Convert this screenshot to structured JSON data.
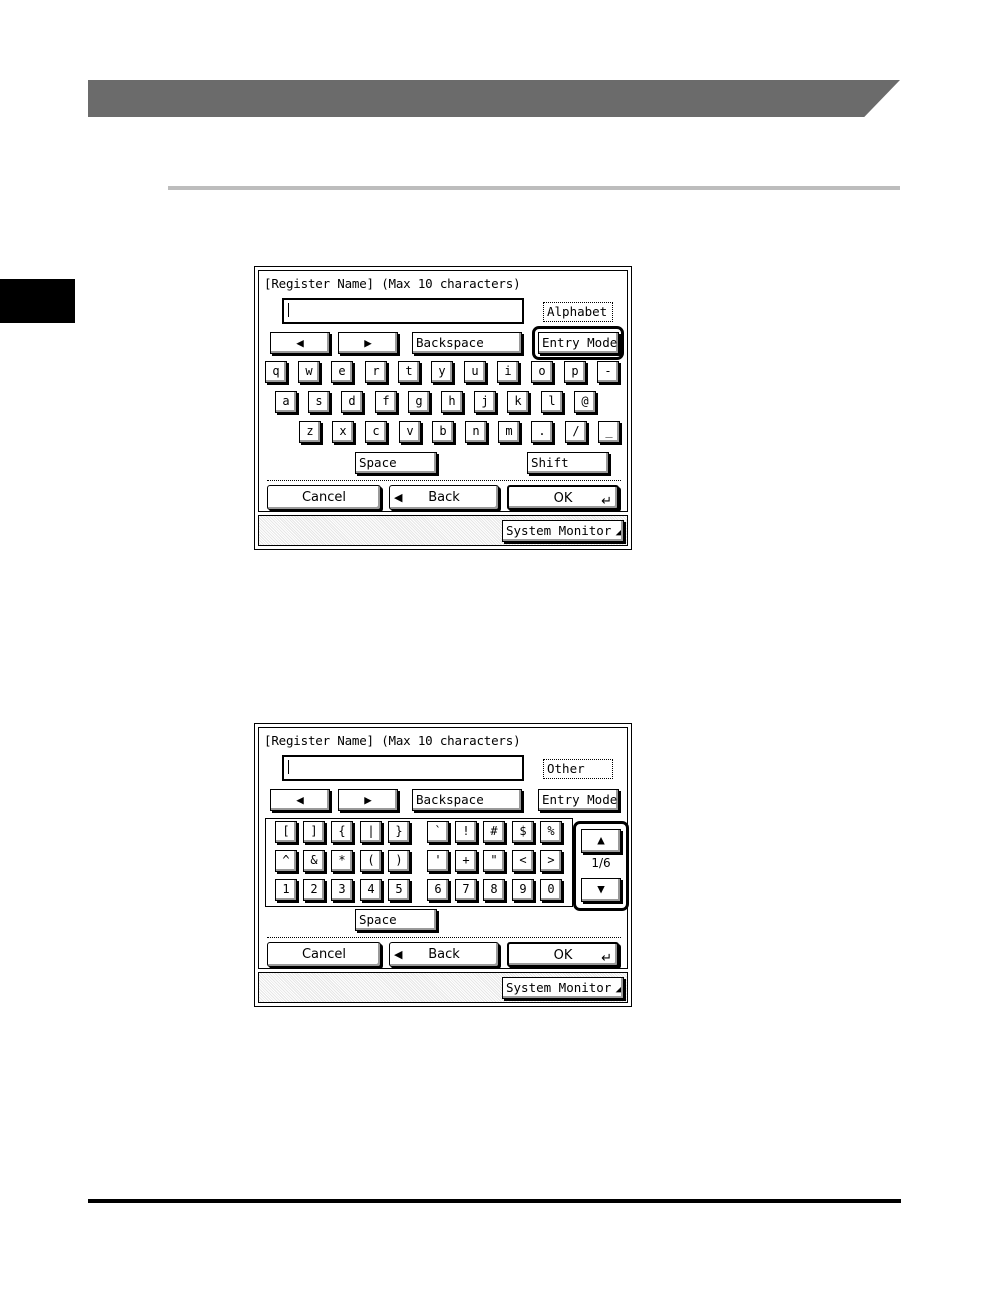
{
  "screen1": {
    "title": "[Register Name] (Max 10 characters)",
    "mode": "Alphabet",
    "left_icon": "◀",
    "right_icon": "▶",
    "backspace": "Backspace",
    "entry_mode": "Entry Mode",
    "rows": [
      [
        "q",
        "w",
        "e",
        "r",
        "t",
        "y",
        "u",
        "i",
        "o",
        "p",
        "-"
      ],
      [
        "a",
        "s",
        "d",
        "f",
        "g",
        "h",
        "j",
        "k",
        "l",
        "@"
      ],
      [
        "z",
        "x",
        "c",
        "v",
        "b",
        "n",
        "m",
        ".",
        "/",
        "_"
      ]
    ],
    "space": "Space",
    "shift": "Shift",
    "cancel": "Cancel",
    "back": "Back",
    "ok": "OK",
    "system_monitor": "System Monitor"
  },
  "screen2": {
    "title": "[Register Name] (Max 10 characters)",
    "mode": "Other",
    "left_icon": "◀",
    "right_icon": "▶",
    "backspace": "Backspace",
    "entry_mode": "Entry Mode",
    "left_rows": [
      [
        "[",
        "]",
        "{",
        "|",
        "}"
      ],
      [
        "^",
        "&",
        "*",
        "(",
        ")"
      ],
      [
        "1",
        "2",
        "3",
        "4",
        "5"
      ]
    ],
    "right_rows": [
      [
        "`",
        "!",
        "#",
        "$",
        "%"
      ],
      [
        "'",
        "+",
        "\"",
        "<",
        ">"
      ],
      [
        "6",
        "7",
        "8",
        "9",
        "0"
      ]
    ],
    "page": "1/6",
    "up_icon": "▲",
    "down_icon": "▼",
    "space": "Space",
    "cancel": "Cancel",
    "back": "Back",
    "ok": "OK",
    "system_monitor": "System Monitor"
  }
}
